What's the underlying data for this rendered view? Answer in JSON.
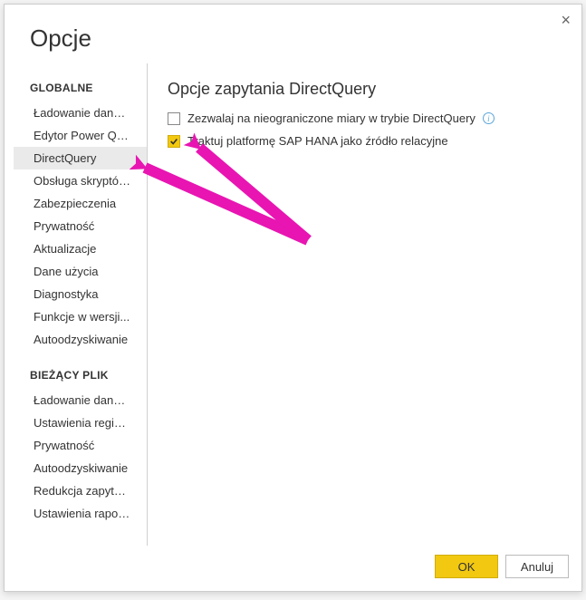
{
  "dialog": {
    "title": "Opcje",
    "close_label": "×"
  },
  "sidebar": {
    "groups": [
      {
        "header": "GLOBALNE",
        "items": [
          {
            "label": "Ładowanie danych",
            "selected": false
          },
          {
            "label": "Edytor Power Query",
            "selected": false
          },
          {
            "label": "DirectQuery",
            "selected": true
          },
          {
            "label": "Obsługa skryptów...",
            "selected": false
          },
          {
            "label": "Zabezpieczenia",
            "selected": false
          },
          {
            "label": "Prywatność",
            "selected": false
          },
          {
            "label": "Aktualizacje",
            "selected": false
          },
          {
            "label": "Dane użycia",
            "selected": false
          },
          {
            "label": "Diagnostyka",
            "selected": false
          },
          {
            "label": "Funkcje w wersji...",
            "selected": false
          },
          {
            "label": "Autoodzyskiwanie",
            "selected": false
          }
        ]
      },
      {
        "header": "BIEŻĄCY PLIK",
        "items": [
          {
            "label": "Ładowanie danych",
            "selected": false
          },
          {
            "label": "Ustawienia regionalne",
            "selected": false
          },
          {
            "label": "Prywatność",
            "selected": false
          },
          {
            "label": "Autoodzyskiwanie",
            "selected": false
          },
          {
            "label": "Redukcja zapytania",
            "selected": false
          },
          {
            "label": "Ustawienia raportu",
            "selected": false
          }
        ]
      }
    ]
  },
  "content": {
    "title": "Opcje zapytania DirectQuery",
    "options": [
      {
        "label": "Zezwalaj na nieograniczone miary w trybie DirectQuery",
        "checked": false,
        "info": true
      },
      {
        "label": "Traktuj platformę SAP HANA jako źródło relacyjne",
        "checked": true,
        "info": false
      }
    ]
  },
  "footer": {
    "ok": "OK",
    "cancel": "Anuluj"
  }
}
